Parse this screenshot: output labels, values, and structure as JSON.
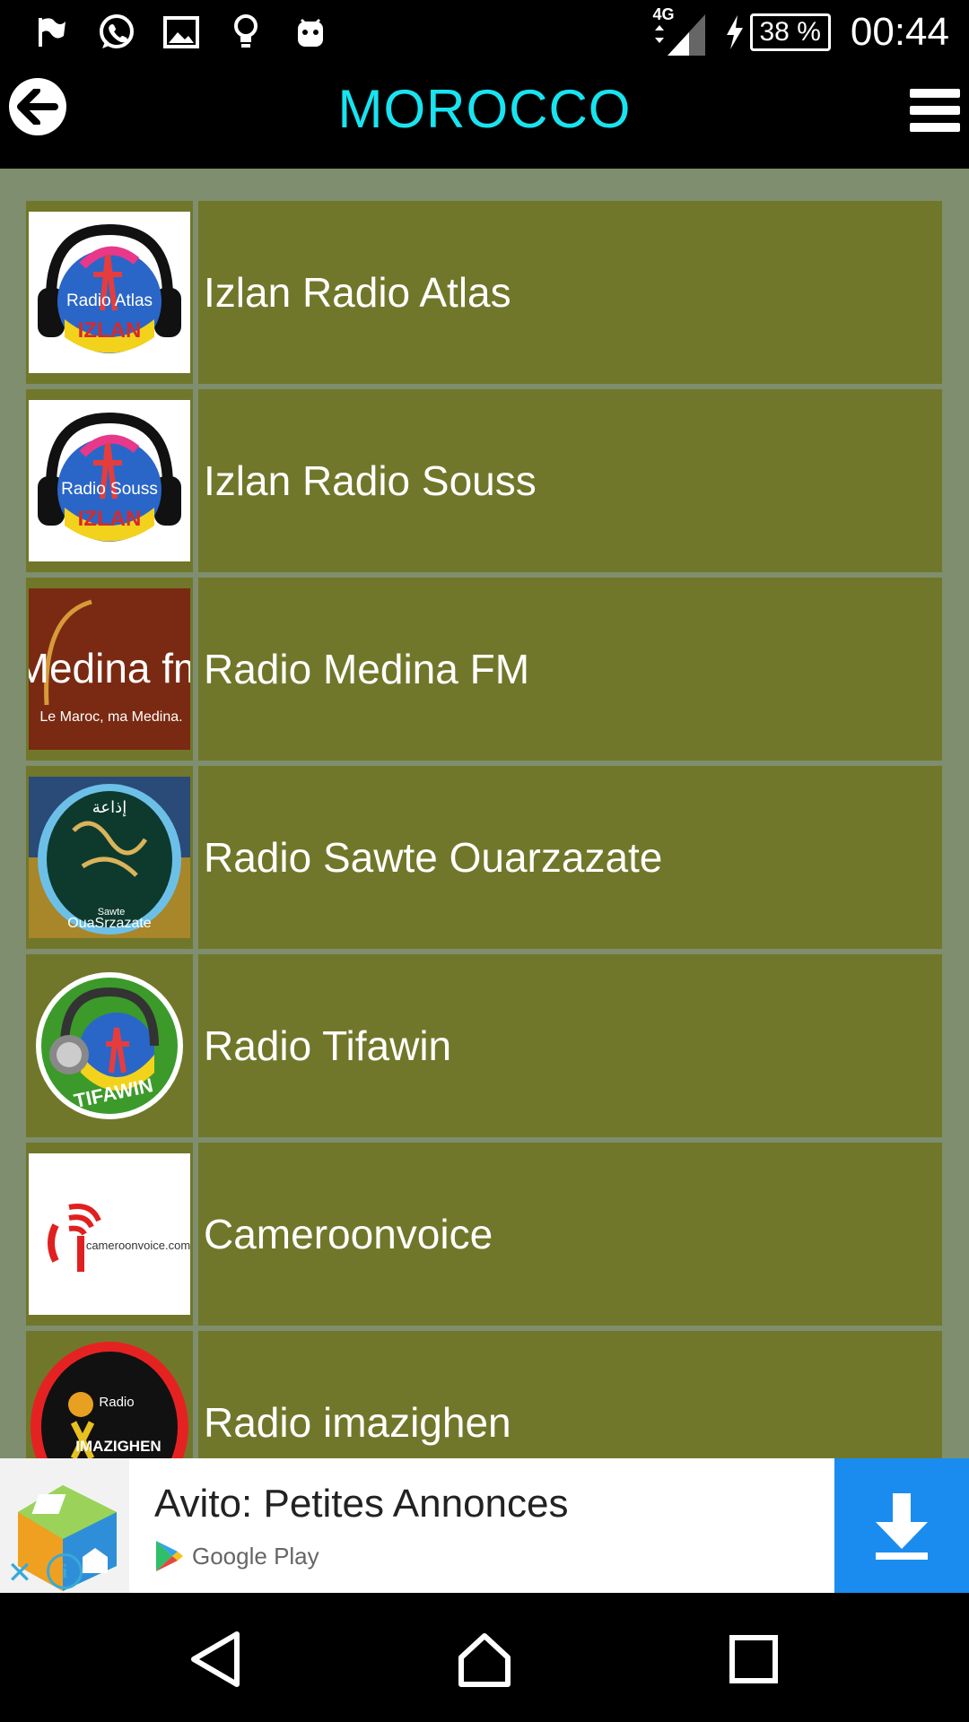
{
  "status_bar": {
    "network": "4G",
    "battery": "38 %",
    "time": "00:44",
    "left_icons": [
      "flag-icon",
      "whatsapp-icon",
      "image-icon",
      "lightbulb-icon",
      "android-icon"
    ]
  },
  "app_bar": {
    "title": "MOROCCO"
  },
  "stations": [
    {
      "name": "Izlan Radio Atlas",
      "logo": "izlan-radio-atlas-logo",
      "logo_text": "Radio Atlas",
      "logo_sub": "IZLAN"
    },
    {
      "name": "Izlan Radio Souss",
      "logo": "izlan-radio-souss-logo",
      "logo_text": "Radio Souss",
      "logo_sub": "IZLAN"
    },
    {
      "name": "Radio Medina FM",
      "logo": "medina-fm-logo",
      "logo_text": "Medina fm",
      "logo_sub": "Le Maroc, ma Medina."
    },
    {
      "name": "Radio Sawte Ouarzazate",
      "logo": "sawte-ouarzazate-logo",
      "logo_text": "Sawte",
      "logo_sub": "OuaSrzazate"
    },
    {
      "name": "Radio Tifawin",
      "logo": "tifawin-logo",
      "logo_text": "TIFAWIN",
      "logo_sub": ""
    },
    {
      "name": "Cameroonvoice",
      "logo": "cameroonvoice-logo",
      "logo_text": "cameroonvoice.com",
      "logo_sub": ""
    },
    {
      "name": "Radio imazighen",
      "logo": "radio-imazighen-logo",
      "logo_text": "Radio",
      "logo_sub": "IMAZIGHEN"
    }
  ],
  "ad": {
    "title": "Avito: Petites Annonces",
    "store": "Google Play"
  },
  "colors": {
    "title": "#18e4f0",
    "row_bg": "#71772a",
    "list_bg": "#7e8e6e",
    "ad_button": "#1a8cf0"
  }
}
